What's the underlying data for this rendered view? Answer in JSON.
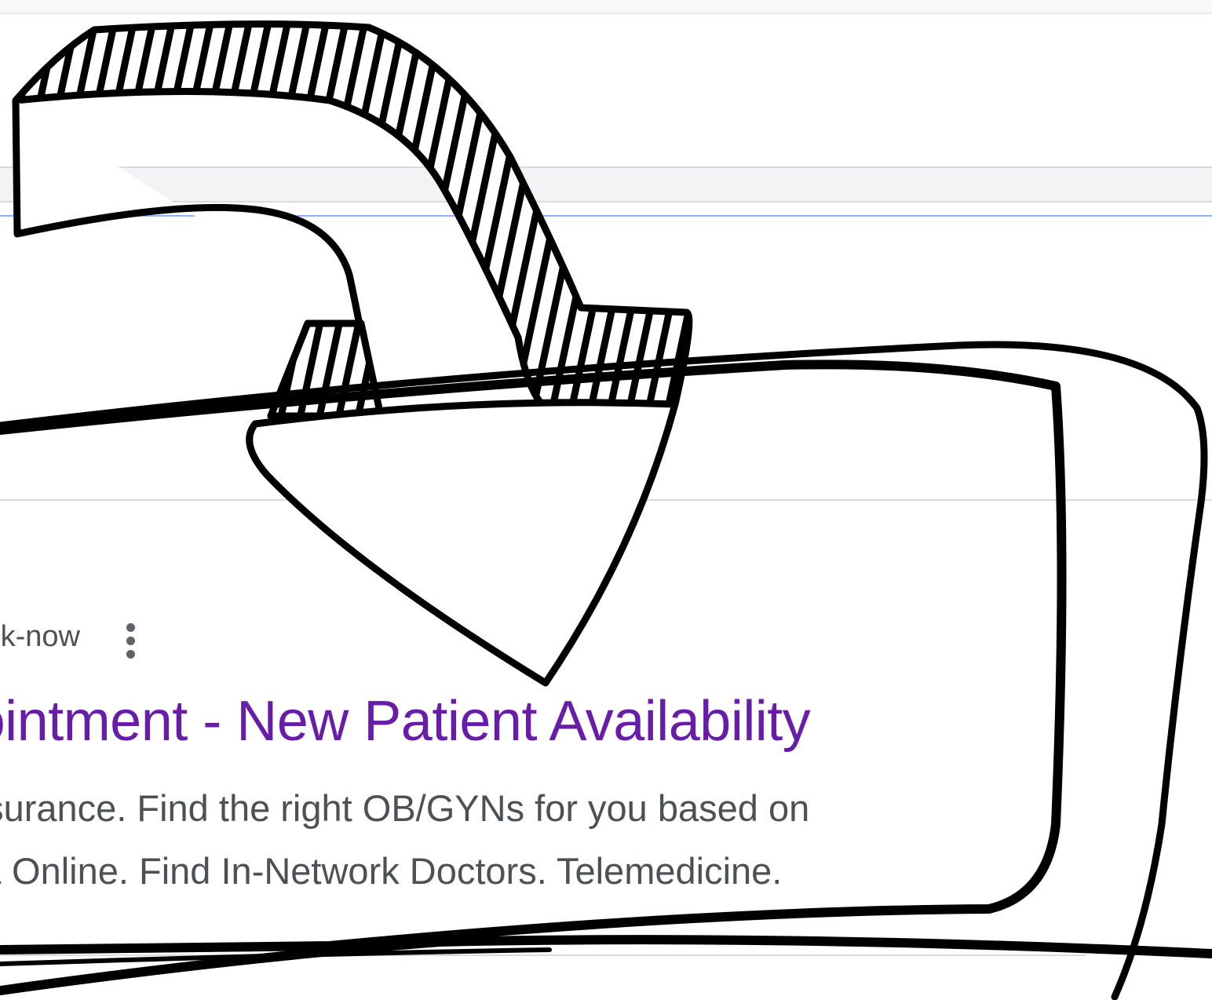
{
  "result": {
    "url_fragment": "k-now",
    "title": "Appointment - New Patient Availability",
    "description_line_1": "your insurance. Find the right OB/GYNs for you based on",
    "description_line_2": "erson & Online. Find In-Network Doctors. Telemedicine."
  },
  "icons": {
    "menu": "three-dot-vertical-icon",
    "annotation": "hand-drawn-curved-arrow-icon"
  },
  "colors": {
    "visited_link": "#681da8",
    "snippet_text": "#4d5156",
    "accent_rule": "#8ab4f8",
    "annotation_ink": "#000000"
  }
}
